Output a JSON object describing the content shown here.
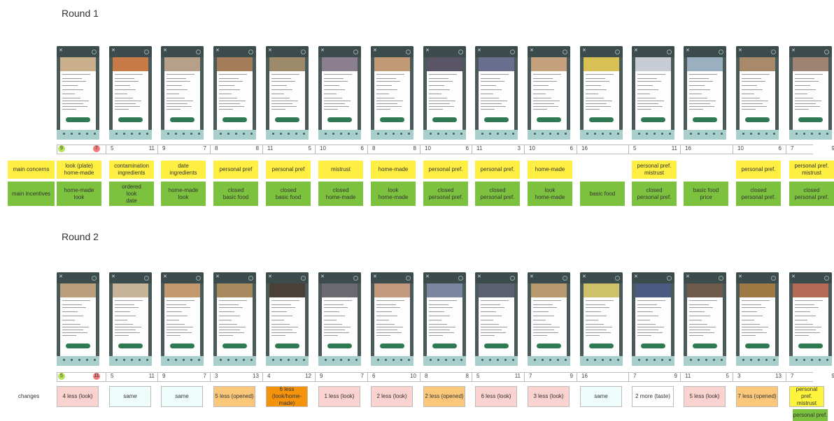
{
  "round1": {
    "title": "Round 1",
    "scale_markers": {
      "green": "9",
      "red": "7"
    },
    "counts": [
      {
        "l": "",
        "r": ""
      },
      {
        "l": "5",
        "r": "11"
      },
      {
        "l": "9",
        "r": "7"
      },
      {
        "l": "8",
        "r": "8"
      },
      {
        "l": "11",
        "r": "5"
      },
      {
        "l": "10",
        "r": "6"
      },
      {
        "l": "8",
        "r": "8"
      },
      {
        "l": "10",
        "r": "6"
      },
      {
        "l": "11",
        "r": "3"
      },
      {
        "l": "10",
        "r": "6"
      },
      {
        "l": "16",
        "r": ""
      },
      {
        "l": "5",
        "r": "11"
      },
      {
        "l": "16",
        "r": ""
      },
      {
        "l": "10",
        "r": "6"
      },
      {
        "l": "7",
        "r": "9"
      }
    ],
    "concerns_label": "main concerns",
    "concerns": [
      "look (plate)\nhome-made",
      "contamination\ningredients",
      "date\ningredients",
      "personal pref",
      "personal pref",
      "mistrust",
      "home-made",
      "personal pref.",
      "personal pref.",
      "home-made",
      "",
      "personal pref.\nmistrust",
      "",
      "personal pref.",
      "personal pref.\nmistrust"
    ],
    "incentives_label": "main incentives",
    "incentives": [
      "home-made\nlook",
      "ordered\nlook\ndate",
      "home-made\nlook",
      "closed\nbasic food",
      "closed\nbasic food",
      "closed\nhome-made",
      "look\nhome-made",
      "closed\npersonal pref.",
      "closed\npersonal pref.",
      "look\nhome-made",
      "basic food",
      "closed\npersonal pref.",
      "basic food\nprice",
      "closed\npersonal pref.",
      "closed\npersonal pref."
    ]
  },
  "round2": {
    "title": "Round 2",
    "scale_markers": {
      "green": "5",
      "red": "11"
    },
    "counts": [
      {
        "l": "",
        "r": ""
      },
      {
        "l": "5",
        "r": "11"
      },
      {
        "l": "9",
        "r": "7"
      },
      {
        "l": "3",
        "r": "13"
      },
      {
        "l": "4",
        "r": "12"
      },
      {
        "l": "9",
        "r": "7"
      },
      {
        "l": "6",
        "r": "10"
      },
      {
        "l": "8",
        "r": "8"
      },
      {
        "l": "5",
        "r": "11"
      },
      {
        "l": "7",
        "r": "9"
      },
      {
        "l": "16",
        "r": ""
      },
      {
        "l": "7",
        "r": "9"
      },
      {
        "l": "11",
        "r": "5"
      },
      {
        "l": "3",
        "r": "13"
      },
      {
        "l": "7",
        "r": "9"
      }
    ],
    "changes_label": "changes",
    "changes": [
      {
        "text": "4 less (look)",
        "color": "pink"
      },
      {
        "text": "same",
        "color": "light"
      },
      {
        "text": "same",
        "color": "light"
      },
      {
        "text": "5 less (opened)",
        "color": "orange"
      },
      {
        "text": "6 less\n(look/home-\nmade)",
        "color": "dorange"
      },
      {
        "text": "1 less (look)",
        "color": "pink"
      },
      {
        "text": "2 less (look)",
        "color": "pink"
      },
      {
        "text": "2 less (opened)",
        "color": "orange"
      },
      {
        "text": "6 less (look)",
        "color": "pink"
      },
      {
        "text": "3 less (look)",
        "color": "pink"
      },
      {
        "text": "same",
        "color": "light"
      },
      {
        "text": "2 more (taste)",
        "color": "white"
      },
      {
        "text": "5 less (look)",
        "color": "pink"
      },
      {
        "text": "7 less (opened)",
        "color": "orange"
      },
      {
        "text": "personal pref.\nmistrust",
        "color": "yellow"
      }
    ],
    "extra_incentive": "personal pref."
  },
  "photos_round1": [
    "#c9b08a",
    "#c77a45",
    "#b7a08a",
    "#a37c5a",
    "#9c8a6a",
    "#8b7f8f",
    "#c29a76",
    "#5a5566",
    "#6b6f8f",
    "#c4a07c",
    "#d9c055",
    "#c7ccd5",
    "#9ab0c0",
    "#a88a6a",
    "#9e8272"
  ],
  "photos_round2": [
    "#b9a07a",
    "#c8b499",
    "#c29a6e",
    "#a78a5e",
    "#4a4038",
    "#6b6a70",
    "#c49a7e",
    "#7d86a0",
    "#5a6070",
    "#b89a6e",
    "#cfc06a",
    "#4b5a80",
    "#6e5a4a",
    "#a07a45",
    "#b46a55"
  ]
}
